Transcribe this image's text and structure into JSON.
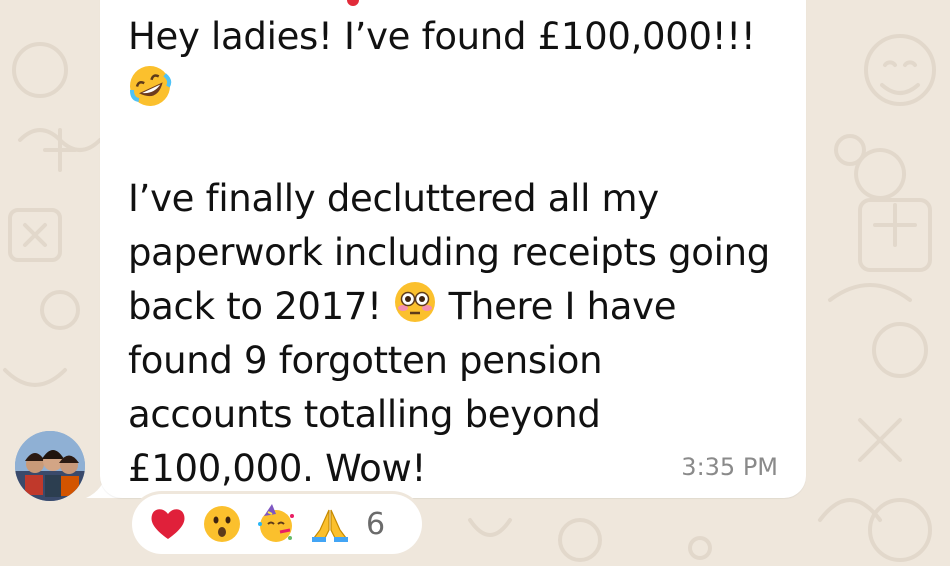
{
  "message": {
    "line1": "Hey ladies! I’ve found £100,000!!!",
    "line2_emoji": "rofl-emoji",
    "para2_a": "I’ve finally decluttered all my\npaperwork including receipts going\nback to 2017! ",
    "para2_emoji": "flushed-emoji",
    "para2_b": " There I have\nfound 9 forgotten pension\naccounts totalling beyond\n£100,000. Wow!",
    "time": "3:35 PM"
  },
  "reactions": {
    "items": [
      "red-heart-emoji",
      "open-mouth-emoji",
      "party-face-emoji",
      "folded-hands-emoji"
    ],
    "count": "6"
  },
  "colors": {
    "background": "#efe7dc",
    "bubble": "#ffffff",
    "text": "#111111",
    "timestamp": "#8a8a8a",
    "sender_accent": "#e12b39"
  }
}
